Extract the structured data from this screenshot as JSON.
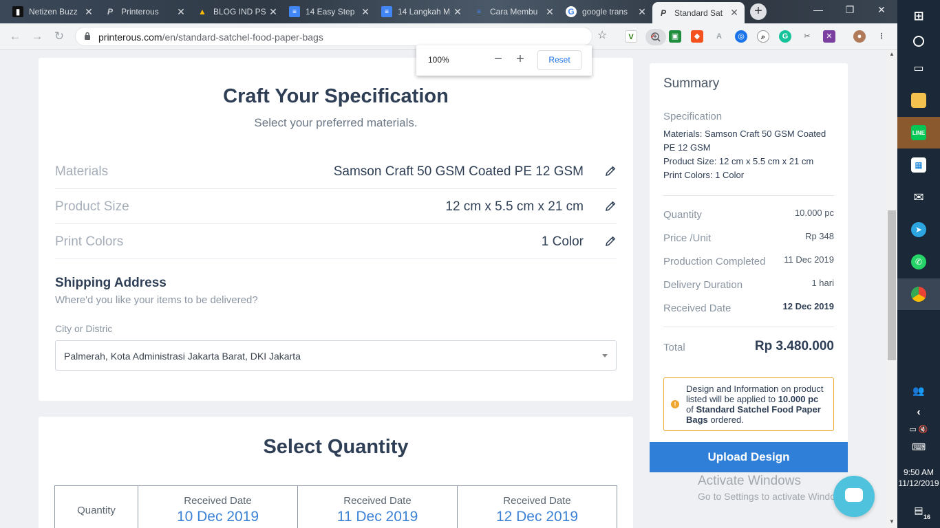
{
  "browser": {
    "tabs": [
      {
        "title": "Netizen Buzz",
        "icon": "netizen-buzz-icon",
        "color": "#222222"
      },
      {
        "title": "Printerous",
        "icon": "printerous-icon",
        "color": "#9aa0a6"
      },
      {
        "title": "BLOG IND PS",
        "icon": "google-drive-icon",
        "color": "#fbbc04"
      },
      {
        "title": "14 Easy Step",
        "icon": "google-docs-icon",
        "color": "#4285f4"
      },
      {
        "title": "14 Langkah M",
        "icon": "google-docs-icon",
        "color": "#4285f4"
      },
      {
        "title": "Cara Membu",
        "icon": "google-docs-icon",
        "color": "#4285f4"
      },
      {
        "title": "google trans",
        "icon": "google-icon",
        "color": "#ea4335"
      },
      {
        "title": "Standard Sat",
        "icon": "printerous-icon",
        "color": "#3c4043"
      }
    ],
    "url_host": "printerous.com",
    "url_path": "/en/standard-satchel-food-paper-bags",
    "zoom": {
      "percent": "100%",
      "reset_label": "Reset",
      "minus": "−",
      "plus": "+"
    }
  },
  "spec": {
    "title": "Craft Your Specification",
    "subtitle": "Select your preferred materials.",
    "rows": [
      {
        "label": "Materials",
        "value": "Samson Craft 50 GSM Coated PE 12 GSM"
      },
      {
        "label": "Product Size",
        "value": "12 cm x 5.5 cm x 21 cm"
      },
      {
        "label": "Print Colors",
        "value": "1 Color"
      }
    ],
    "shipping_title": "Shipping Address",
    "shipping_subtitle": "Where'd you like your items to be delivered?",
    "city_label": "City or Distric",
    "city_value": "Palmerah, Kota Administrasi Jakarta Barat, DKI Jakarta"
  },
  "quantity": {
    "title": "Select Quantity",
    "first_col": "Quantity",
    "columns": [
      {
        "header": "Received Date",
        "date": "10 Dec 2019"
      },
      {
        "header": "Received Date",
        "date": "11 Dec 2019"
      },
      {
        "header": "Received Date",
        "date": "12 Dec 2019"
      }
    ]
  },
  "summary": {
    "title": "Summary",
    "spec_heading": "Specification",
    "spec_lines": [
      "Materials: Samson Craft 50 GSM Coated PE 12 GSM",
      "Product Size: 12 cm x 5.5 cm x 21 cm",
      "Print Colors: 1 Color"
    ],
    "rows": [
      {
        "label": "Quantity",
        "value": "10.000 pc"
      },
      {
        "label": "Price /Unit",
        "value": "Rp 348"
      },
      {
        "label": "Production Completed",
        "value": "11 Dec 2019"
      },
      {
        "label": "Delivery Duration",
        "value": "1 hari"
      },
      {
        "label": "Received Date",
        "value": "12 Dec 2019"
      }
    ],
    "total_label": "Total",
    "total_value": "Rp 3.480.000",
    "note_pre": "Design and Information on product listed will be applied to ",
    "note_qty": "10.000 pc",
    "note_mid": " of ",
    "note_product": "Standard Satchel Food Paper Bags",
    "note_post": " ordered.",
    "upload_label": "Upload Design"
  },
  "watermark": {
    "line1": "Activate Windows",
    "line2": "Go to Settings to activate Windows."
  },
  "taskbar": {
    "time": "9:50 AM",
    "date": "11/12/2019",
    "notifications": "16"
  }
}
